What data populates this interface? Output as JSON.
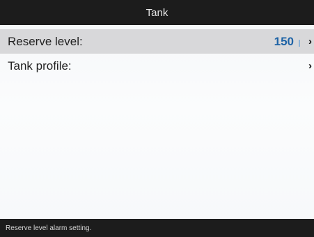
{
  "title_bar": {
    "title": "Tank"
  },
  "menu": {
    "items": [
      {
        "label": "Reserve level:",
        "value": "150",
        "selected": true,
        "chevron": "›",
        "icon": "chevron-right-icon"
      },
      {
        "label": "Tank profile:",
        "value": "",
        "selected": false,
        "chevron": "›",
        "icon": "chevron-right-icon"
      }
    ]
  },
  "status_bar": {
    "text": "Reserve level alarm setting."
  },
  "colors": {
    "bar_background": "#1c1c1c",
    "selected_row": "#d8d8da",
    "value_accent": "#1e63a6"
  }
}
